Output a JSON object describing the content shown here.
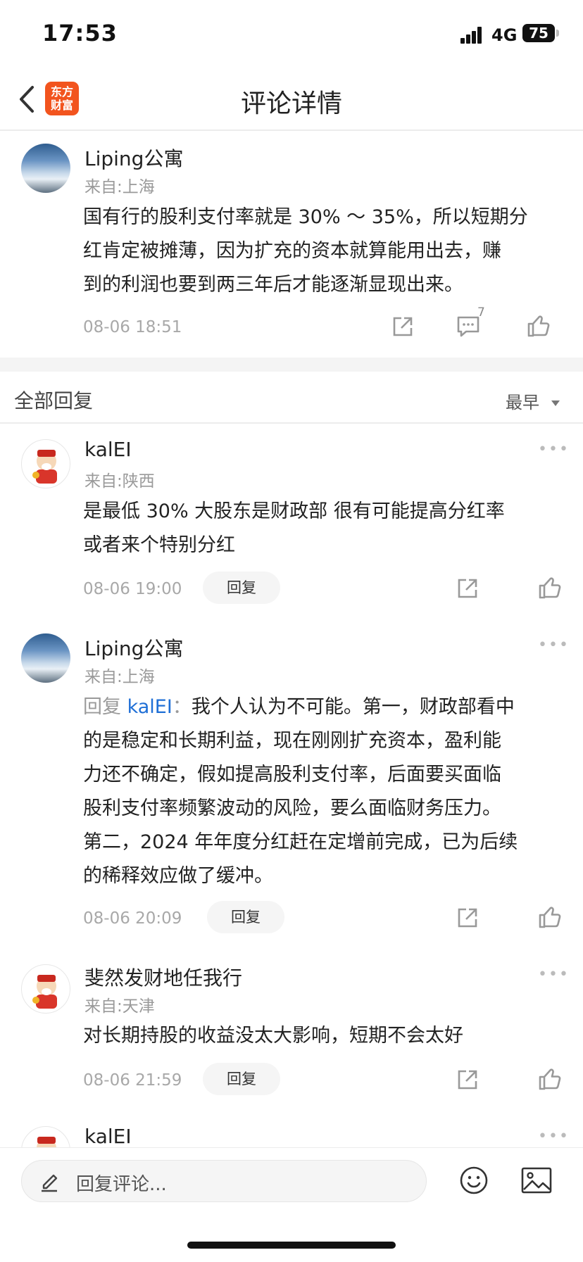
{
  "status_bar": {
    "time": "17:53",
    "network": "4G",
    "battery": "75"
  },
  "nav": {
    "title": "评论详情",
    "logo_line1": "东方",
    "logo_line2": "财富"
  },
  "main_comment": {
    "user": "Liping公寓",
    "from": "来自:上海",
    "text_lines": [
      "国有行的股利支付率就是 30% ～ 35%，所以短期分",
      "红肯定被摊薄，因为扩充的资本就算能用出去，赚",
      "到的利润也要到两三年后才能逐渐显现出来。"
    ],
    "time": "08-06 18:51",
    "comment_count": "7"
  },
  "replies_header": {
    "title": "全部回复",
    "sort": "最早"
  },
  "replies": [
    {
      "user": "kalEI",
      "from": "来自:陕西",
      "text_lines": [
        "是最低 30% 大股东是财政部 很有可能提高分红率",
        "或者来个特别分红"
      ],
      "time": "08-06 19:00",
      "reply_label": "回复"
    },
    {
      "user": "Liping公寓",
      "from": "来自:上海",
      "reply_prefix": "回复 ",
      "mention": "kalEI",
      "colon": "：",
      "first_line_rest": "我个人认为不可能。第一，财政部看中",
      "text_lines": [
        "的是稳定和长期利益，现在刚刚扩充资本，盈利能",
        "力还不确定，假如提高股利支付率，后面要买面临",
        "股利支付率频繁波动的风险，要么面临财务压力。",
        "第二，2024 年年度分红赶在定增前完成，已为后续",
        "的稀释效应做了缓冲。"
      ],
      "time": "08-06 20:09",
      "reply_label": "回复"
    },
    {
      "user": "斐然发财地任我行",
      "from": "来自:天津",
      "text_lines": [
        "对长期持股的收益没太大影响，短期不会太好"
      ],
      "time": "08-06 21:59",
      "reply_label": "回复"
    },
    {
      "user": "kalEI"
    }
  ],
  "bottom_bar": {
    "placeholder": "回复评论..."
  },
  "icons": {
    "back": "chevron-left-icon",
    "share": "share-icon",
    "comment": "comment-icon",
    "like": "thumbs-up-icon",
    "more": "more-icon",
    "edit": "pencil-icon",
    "emoji": "smiley-icon",
    "image": "image-icon",
    "sort": "caret-down-icon"
  }
}
